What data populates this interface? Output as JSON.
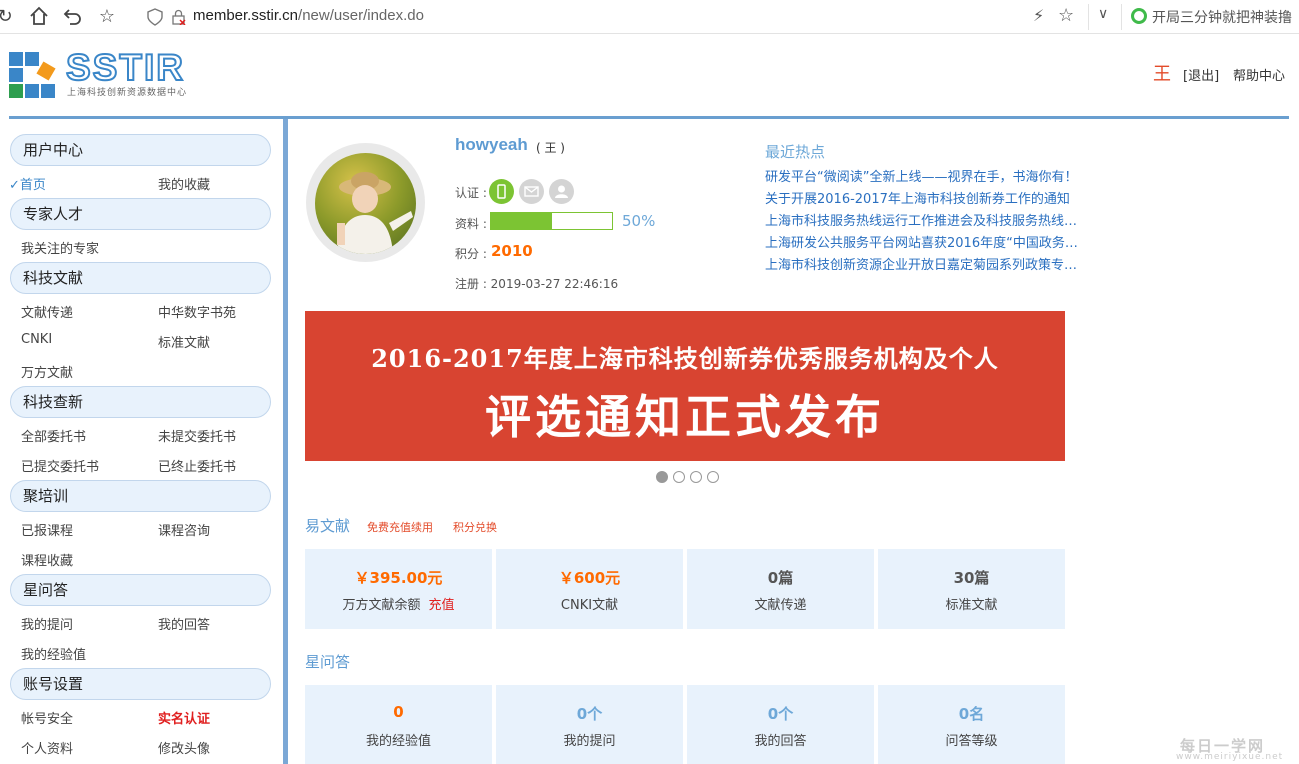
{
  "browser": {
    "url_host": "member.sstir.cn",
    "url_path": "/new/user/index.do",
    "news_text": "开局三分钟就把神装撸"
  },
  "header": {
    "logo_text": "SSTIR",
    "logo_subtitle": "上海科技创新资源数据中心",
    "user_name": "王",
    "logout_label": "[退出]",
    "help_label": "帮助中心"
  },
  "sidebar": {
    "sections": [
      {
        "title": "用户中心",
        "links": [
          "首页",
          "我的收藏"
        ]
      },
      {
        "title": "专家人才",
        "links": [
          "我关注的专家"
        ]
      },
      {
        "title": "科技文献",
        "links": [
          "文献传递",
          "中华数字书苑",
          "CNKI",
          "标准文献",
          "万方文献"
        ]
      },
      {
        "title": "科技查新",
        "links": [
          "全部委托书",
          "未提交委托书",
          "已提交委托书",
          "已终止委托书"
        ]
      },
      {
        "title": "聚培训",
        "links": [
          "已报课程",
          "课程咨询",
          "课程收藏"
        ]
      },
      {
        "title": "星问答",
        "links": [
          "我的提问",
          "我的回答",
          "我的经验值"
        ]
      },
      {
        "title": "账号设置",
        "links": [
          "帐号安全",
          "实名认证",
          "个人资料",
          "修改头像"
        ]
      }
    ]
  },
  "profile": {
    "username": "howyeah",
    "alias": "( 王 )",
    "cert_label": "认证 :",
    "data_label": "资料 :",
    "completeness": 0.5,
    "completeness_text": "50%",
    "score_label": "积分 :",
    "score": "2010",
    "register_text": "注册 : 2019-03-27 22:46:16"
  },
  "hot": {
    "title": "最近热点",
    "items": [
      "研发平台“微阅读”全新上线——视界在手，书海你有！",
      "关于开展2016-2017年上海市科技创新券工作的通知",
      "上海市科技服务热线运行工作推进会及科技服务热线…",
      "上海研发公共服务平台网站喜获2016年度“中国政务…",
      "上海市科技创新资源企业开放日嘉定菊园系列政策专…"
    ]
  },
  "banner": {
    "line1": "2016-2017年度上海市科技创新券优秀服务机构及个人",
    "line2": "评选通知正式发布",
    "active_slide": 1,
    "slide_count": 4
  },
  "ywx": {
    "title": "易文献",
    "recharge_link": "免费充值续用",
    "exchange_link": "积分兑换",
    "cards": [
      {
        "value": "￥395.00元",
        "label": "万方文献余额",
        "extra": "充值"
      },
      {
        "value": "￥600元",
        "label": "CNKI文献"
      },
      {
        "value": "0篇",
        "label": "文献传递"
      },
      {
        "value": "30篇",
        "label": "标准文献"
      }
    ]
  },
  "xwd": {
    "title": "星问答",
    "cards": [
      {
        "value": "0",
        "label": "我的经验值"
      },
      {
        "value": "0个",
        "label": "我的提问"
      },
      {
        "value": "0个",
        "label": "我的回答"
      },
      {
        "value": "0名",
        "label": "问答等级"
      }
    ]
  },
  "watermark": {
    "line1": "每日一学网",
    "line2": "www.meiriyixue.net"
  },
  "icons": [
    "refresh-icon",
    "home-icon",
    "back-icon",
    "star-icon",
    "shield-icon",
    "lock-icon",
    "bolt-icon",
    "chevron-down-icon",
    "phone-icon",
    "mail-icon",
    "person-icon"
  ],
  "colors": {
    "accent_blue": "#5e9bd2",
    "brand_orange": "#ff6a00",
    "banner_red": "#d84431",
    "progress_green": "#7cc433"
  }
}
